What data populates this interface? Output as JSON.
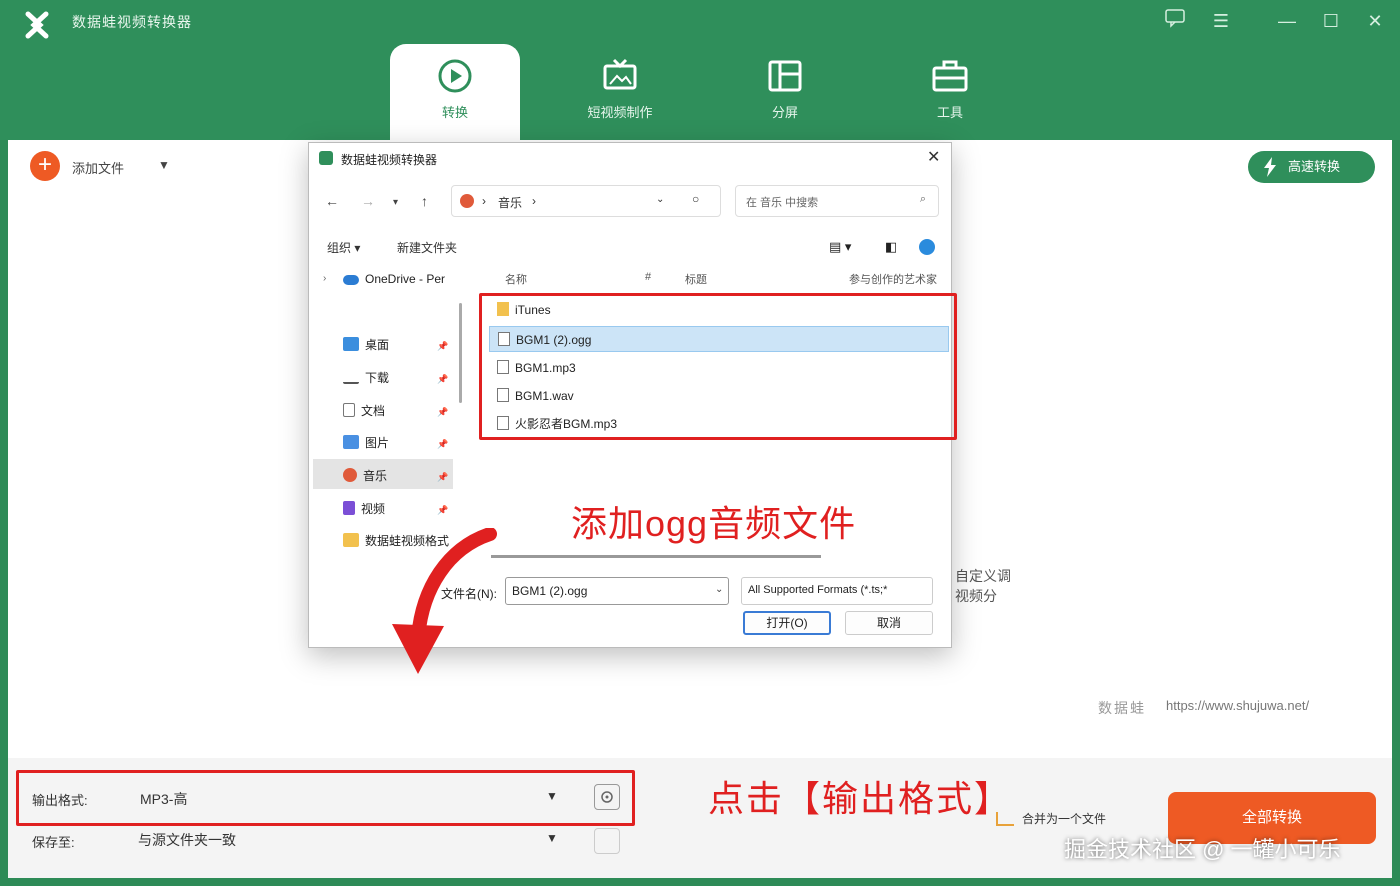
{
  "app": {
    "title": "数据蛙视频转换器",
    "window_controls": [
      "feedback-icon",
      "menu-icon",
      "minimize-icon",
      "maximize-icon",
      "close-icon"
    ]
  },
  "nav_tabs": [
    {
      "label": "转换",
      "icon": "convert-icon",
      "active": true
    },
    {
      "label": "短视频制作",
      "icon": "tv-icon",
      "active": false
    },
    {
      "label": "分屏",
      "icon": "split-screen-icon",
      "active": false
    },
    {
      "label": "工具",
      "icon": "toolbox-icon",
      "active": false
    }
  ],
  "toolbar": {
    "add_file_label": "添加文件",
    "fast_convert_label": "高速转换"
  },
  "main": {
    "side_text_1": "自定义调",
    "side_text_2": "视频分",
    "brand": "数据蛙",
    "url": "https://www.shujuwa.net/"
  },
  "bottom": {
    "output_format_label": "输出格式:",
    "output_format_value": "MP3-高",
    "save_to_label": "保存至:",
    "save_to_value": "与源文件夹一致",
    "merge_label": "合并为一个文件",
    "convert_all_label": "全部转换"
  },
  "annotations": {
    "add_ogg": "添加ogg音频文件",
    "click_format": "点击【输出格式】",
    "watermark": "掘金技术社区 @ 一罐小可乐"
  },
  "dialog": {
    "title": "数据蛙视频转换器",
    "path_segment": "音乐",
    "search_placeholder": "在 音乐 中搜索",
    "organize_label": "组织 ▾",
    "new_folder_label": "新建文件夹",
    "tree": [
      {
        "label": "OneDrive - Per",
        "icon": "onedrive-icon"
      },
      {
        "label": "桌面",
        "icon": "desktop-icon"
      },
      {
        "label": "下载",
        "icon": "download-icon"
      },
      {
        "label": "文档",
        "icon": "document-icon"
      },
      {
        "label": "图片",
        "icon": "picture-icon"
      },
      {
        "label": "音乐",
        "icon": "music-icon"
      },
      {
        "label": "视频",
        "icon": "video-icon"
      },
      {
        "label": "数据蛙视频格式",
        "icon": "folder-icon"
      }
    ],
    "columns": [
      "名称",
      "#",
      "标题",
      "参与创作的艺术家"
    ],
    "files": [
      {
        "name": "iTunes",
        "type": "folder"
      },
      {
        "name": "BGM1 (2).ogg",
        "type": "audio",
        "selected": true
      },
      {
        "name": "BGM1.mp3",
        "type": "audio"
      },
      {
        "name": "BGM1.wav",
        "type": "audio"
      },
      {
        "name": "火影忍者BGM.mp3",
        "type": "audio"
      }
    ],
    "filename_label": "文件名(N):",
    "filename_value": "BGM1 (2).ogg",
    "filetype_value": "All Supported Formats (*.ts;*",
    "open_label": "打开(O)",
    "cancel_label": "取消"
  },
  "colors": {
    "brand_green": "#2f8f5b",
    "accent_orange": "#ee5a24",
    "annotation_red": "#e02020"
  }
}
